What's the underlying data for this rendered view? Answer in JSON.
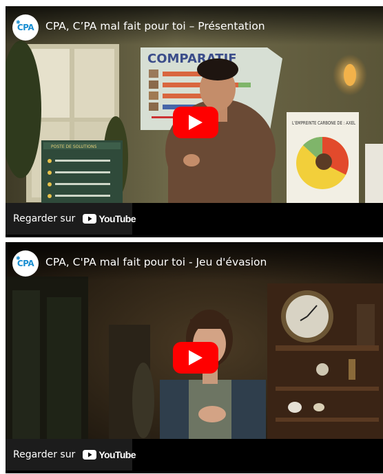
{
  "videos": [
    {
      "channel": {
        "logo_text": "CPA",
        "logo_icon": "cpa-star-icon"
      },
      "title": "CPA, C’PA mal fait pour toi – Présentation",
      "thumbnail_text": {
        "board_title": "COMPARATIF",
        "chart_board_title": "L'EMPREINTE CARBONE DE : AXEL",
        "left_board_title": "POSTE DE SOLUTIONS"
      },
      "play_icon": "play-icon",
      "watch_on": {
        "label": "Regarder sur",
        "logo_text": "YouTube"
      }
    },
    {
      "channel": {
        "logo_text": "CPA",
        "logo_icon": "cpa-star-icon"
      },
      "title": "CPA, C'PA mal fait pour toi - Jeu d'évasion",
      "play_icon": "play-icon",
      "watch_on": {
        "label": "Regarder sur",
        "logo_text": "YouTube"
      }
    }
  ],
  "colors": {
    "play_red": "#ff0000",
    "cpa_blue": "#1b8fd2",
    "bar_bg": "#1e1e1e"
  }
}
